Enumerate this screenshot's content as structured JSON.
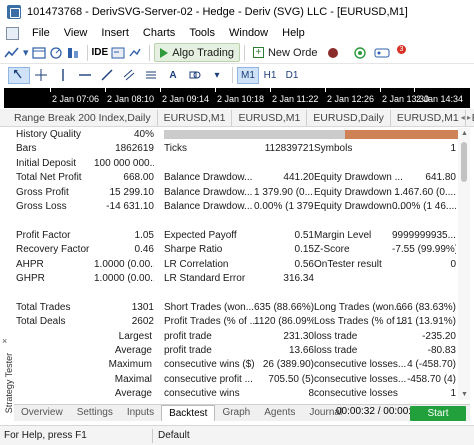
{
  "window": {
    "title": "101473768 - DerivSVG-Server-02 - Hedge - Deriv (SVG) LLC - [EURUSD,M1]"
  },
  "menu": {
    "items": [
      "File",
      "View",
      "Insert",
      "Charts",
      "Tools",
      "Window",
      "Help"
    ]
  },
  "toolbar": {
    "ide_label": "IDE",
    "algo_trading_label": "Algo Trading",
    "new_order_label": "New Orde",
    "notification_count": "3",
    "timeframes": [
      "M1",
      "H1",
      "D1"
    ],
    "active_timeframe": "M1"
  },
  "timeline": {
    "labels": [
      "2 Jan 07:06",
      "2 Jan 08:10",
      "2 Jan 09:14",
      "2 Jan 10:18",
      "2 Jan 11:22",
      "2 Jan 12:26",
      "2 Jan 13:30",
      "2 Jan 14:34"
    ]
  },
  "chart_tabs": [
    "Range Break 200 Index,Daily",
    "EURUSD,M1",
    "EURUSD,M1",
    "EURUSD,Daily",
    "EURUSD,M1",
    "EU"
  ],
  "report": {
    "history_quality": {
      "label": "History Quality",
      "value": "40%",
      "fraction": 0.4
    },
    "rows": [
      {
        "c1": "Bars",
        "v1": "1862619",
        "c2": "Ticks",
        "v2": "112839721",
        "c3": "Symbols",
        "v3": "1"
      },
      {
        "c1": "Initial Deposit",
        "v1": "100 000 000...",
        "c2": "",
        "v2": "",
        "c3": "",
        "v3": ""
      },
      {
        "c1": "Total Net Profit",
        "v1": "668.00",
        "c2": "Balance Drawdow...",
        "v2": "441.20",
        "c3": "Equity Drawdown ...",
        "v3": "641.80"
      },
      {
        "c1": "Gross Profit",
        "v1": "15 299.10",
        "c2": "Balance Drawdow...",
        "v2": "1 379.90 (0....",
        "c3": "Equity Drawdown ...",
        "v3": "1 467.60 (0...."
      },
      {
        "c1": "Gross Loss",
        "v1": "-14 631.10",
        "c2": "Balance Drawdow...",
        "v2": "0.00% (1 379....",
        "c3": "Equity Drawdown ...",
        "v3": "0.00% (1 46...."
      },
      {
        "c1": "",
        "v1": "",
        "c2": "",
        "v2": "",
        "c3": "",
        "v3": ""
      },
      {
        "c1": "Profit Factor",
        "v1": "1.05",
        "c2": "Expected Payoff",
        "v2": "0.51",
        "c3": "Margin Level",
        "v3": "9999999935...."
      },
      {
        "c1": "Recovery Factor",
        "v1": "0.46",
        "c2": "Sharpe Ratio",
        "v2": "0.15",
        "c3": "Z-Score",
        "v3": "-7.55 (99.99%)"
      },
      {
        "c1": "AHPR",
        "v1": "1.0000 (0.00...",
        "c2": "LR Correlation",
        "v2": "0.56",
        "c3": "OnTester result",
        "v3": "0"
      },
      {
        "c1": "GHPR",
        "v1": "1.0000 (0.00...",
        "c2": "LR Standard Error",
        "v2": "316.34",
        "c3": "",
        "v3": ""
      },
      {
        "c1": "",
        "v1": "",
        "c2": "",
        "v2": "",
        "c3": "",
        "v3": ""
      },
      {
        "c1": "Total Trades",
        "v1": "1301",
        "c2": "Short Trades (won...",
        "v2": "635 (88.66%)",
        "c3": "Long Trades (won...",
        "v3": "666 (83.63%)"
      },
      {
        "c1": "Total Deals",
        "v1": "2602",
        "c2": "Profit Trades (% of ...",
        "v2": "1120 (86.09%)",
        "c3": "Loss Trades (% of ...",
        "v3": "181 (13.91%)"
      },
      {
        "c1": "Largest",
        "v1": "",
        "c2": "profit trade",
        "v2": "231.30",
        "c3": "loss trade",
        "v3": "-235.20",
        "indent": true
      },
      {
        "c1": "Average",
        "v1": "",
        "c2": "profit trade",
        "v2": "13.66",
        "c3": "loss trade",
        "v3": "-80.83",
        "indent": true
      },
      {
        "c1": "Maximum",
        "v1": "",
        "c2": "consecutive wins ($)",
        "v2": "26 (389.90)",
        "c3": "consecutive losses...",
        "v3": "4 (-458.70)",
        "indent": true
      },
      {
        "c1": "Maximal",
        "v1": "",
        "c2": "consecutive profit ...",
        "v2": "705.50 (5)",
        "c3": "consecutive losses...",
        "v3": "-458.70 (4)",
        "indent": true
      },
      {
        "c1": "Average",
        "v1": "",
        "c2": "consecutive wins",
        "v2": "8",
        "c3": "consecutive losses",
        "v3": "1",
        "indent": true
      }
    ]
  },
  "side_panel": {
    "label": "Strategy Tester",
    "close_glyph": "×"
  },
  "bottom_tabs": {
    "items": [
      "Overview",
      "Settings",
      "Inputs",
      "Backtest",
      "Graph",
      "Agents",
      "Journal"
    ],
    "active": "Backtest",
    "timer": "00:00:32 / 00:00:32",
    "start_label": "Start"
  },
  "status": {
    "help": "For Help, press F1",
    "profile": "Default"
  },
  "colors": {
    "quality_bar_fill": "#cf8256",
    "quality_bar_bg": "#cbcbcb",
    "start_button": "#21a03c",
    "timeline_bg": "#000000"
  }
}
